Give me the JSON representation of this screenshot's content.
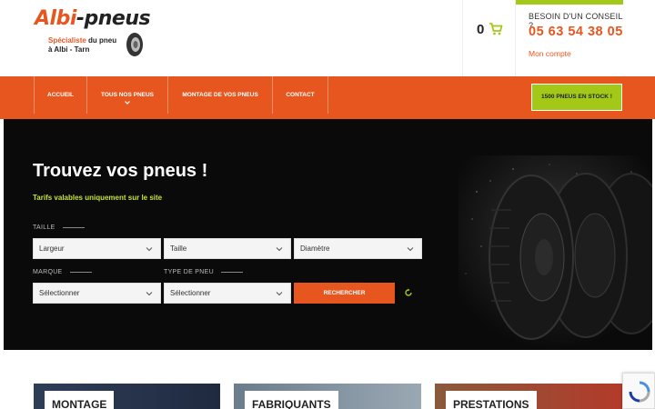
{
  "logo": {
    "brand_part1": "Albi",
    "brand_part2": "-pneus",
    "tag_highlight": "Spécialiste",
    "tag_line1_rest": " du pneu",
    "tag_line2": "à Albi - Tarn"
  },
  "cart": {
    "count": "0",
    "icon": "cart-icon"
  },
  "advice": {
    "title": "BESOIN D'UN CONSEIL ?",
    "phone": "05 63 54 38 05",
    "account": "Mon compte"
  },
  "nav": {
    "items": [
      {
        "label": "ACCUEIL"
      },
      {
        "label": "TOUS NOS PNEUS"
      },
      {
        "label": "MONTAGE DE VOS PNEUS"
      },
      {
        "label": "CONTACT"
      }
    ],
    "stock_button": "1500 PNEUS EN STOCK !"
  },
  "hero": {
    "title": "Trouvez vos pneus !",
    "subtitle": "Tarifs valables uniquement sur le site",
    "label_taille": "TAILLE",
    "label_marque": "MARQUE",
    "label_type": "TYPE DE PNEU",
    "select_largeur": "Largeur",
    "select_taille": "Taille",
    "select_diametre": "Diamètre",
    "select_marque": "Sélectionner",
    "select_type": "Sélectionner",
    "search_button": "RECHERCHER"
  },
  "cards": [
    {
      "label": "MONTAGE"
    },
    {
      "label": "FABRIQUANTS"
    },
    {
      "label": "PRESTATIONS"
    }
  ],
  "colors": {
    "brand_orange": "#e8561f",
    "accent_green": "#a3c817",
    "hero_bg": "#0a0a0a"
  }
}
